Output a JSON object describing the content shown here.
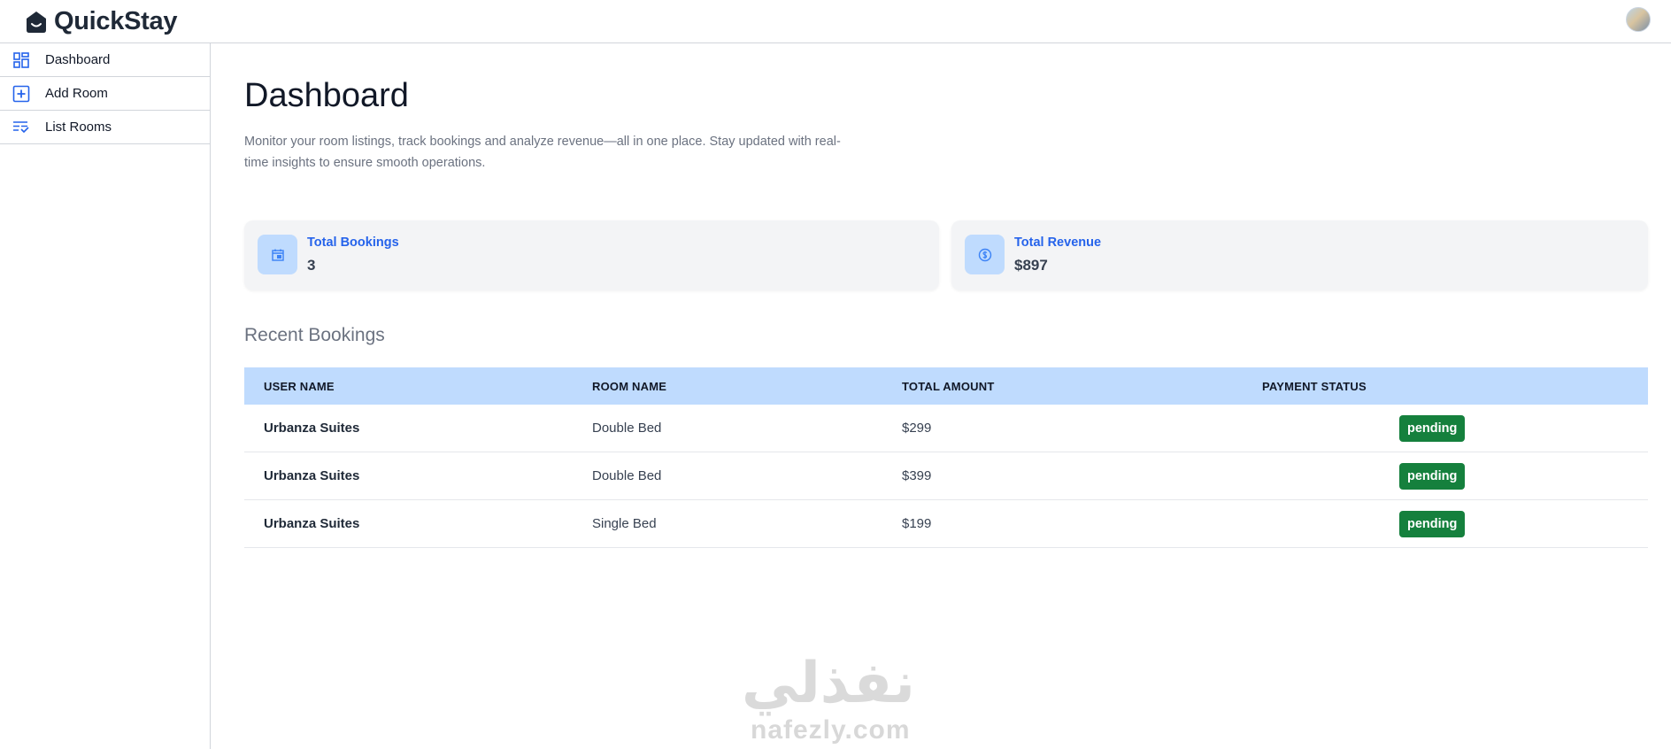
{
  "app": {
    "name": "QuickStay"
  },
  "sidebar": {
    "items": [
      {
        "label": "Dashboard",
        "icon": "dashboard-icon"
      },
      {
        "label": "Add Room",
        "icon": "add-room-icon"
      },
      {
        "label": "List Rooms",
        "icon": "list-rooms-icon"
      }
    ]
  },
  "page": {
    "title": "Dashboard",
    "description": "Monitor your room listings, track bookings and analyze revenue—all in one place. Stay updated with real-time insights to ensure smooth operations."
  },
  "stats": [
    {
      "title": "Total Bookings",
      "value": "3",
      "icon": "calendar-icon"
    },
    {
      "title": "Total Revenue",
      "value": "$897",
      "icon": "dollar-icon"
    }
  ],
  "recent": {
    "title": "Recent Bookings",
    "headers": [
      "USER NAME",
      "ROOM NAME",
      "TOTAL AMOUNT",
      "PAYMENT STATUS"
    ],
    "rows": [
      {
        "user": "Urbanza Suites",
        "room": "Double Bed",
        "amount": "$299",
        "status": "pending"
      },
      {
        "user": "Urbanza Suites",
        "room": "Double Bed",
        "amount": "$399",
        "status": "pending"
      },
      {
        "user": "Urbanza Suites",
        "room": "Single Bed",
        "amount": "$199",
        "status": "pending"
      }
    ]
  },
  "watermark": {
    "arabic": "نفذلي",
    "latin": "nafezly.com"
  },
  "colors": {
    "accent": "#2563eb",
    "header_bg": "#bfdbfe",
    "card_bg": "#f3f4f6",
    "status_pending": "#15803d"
  }
}
